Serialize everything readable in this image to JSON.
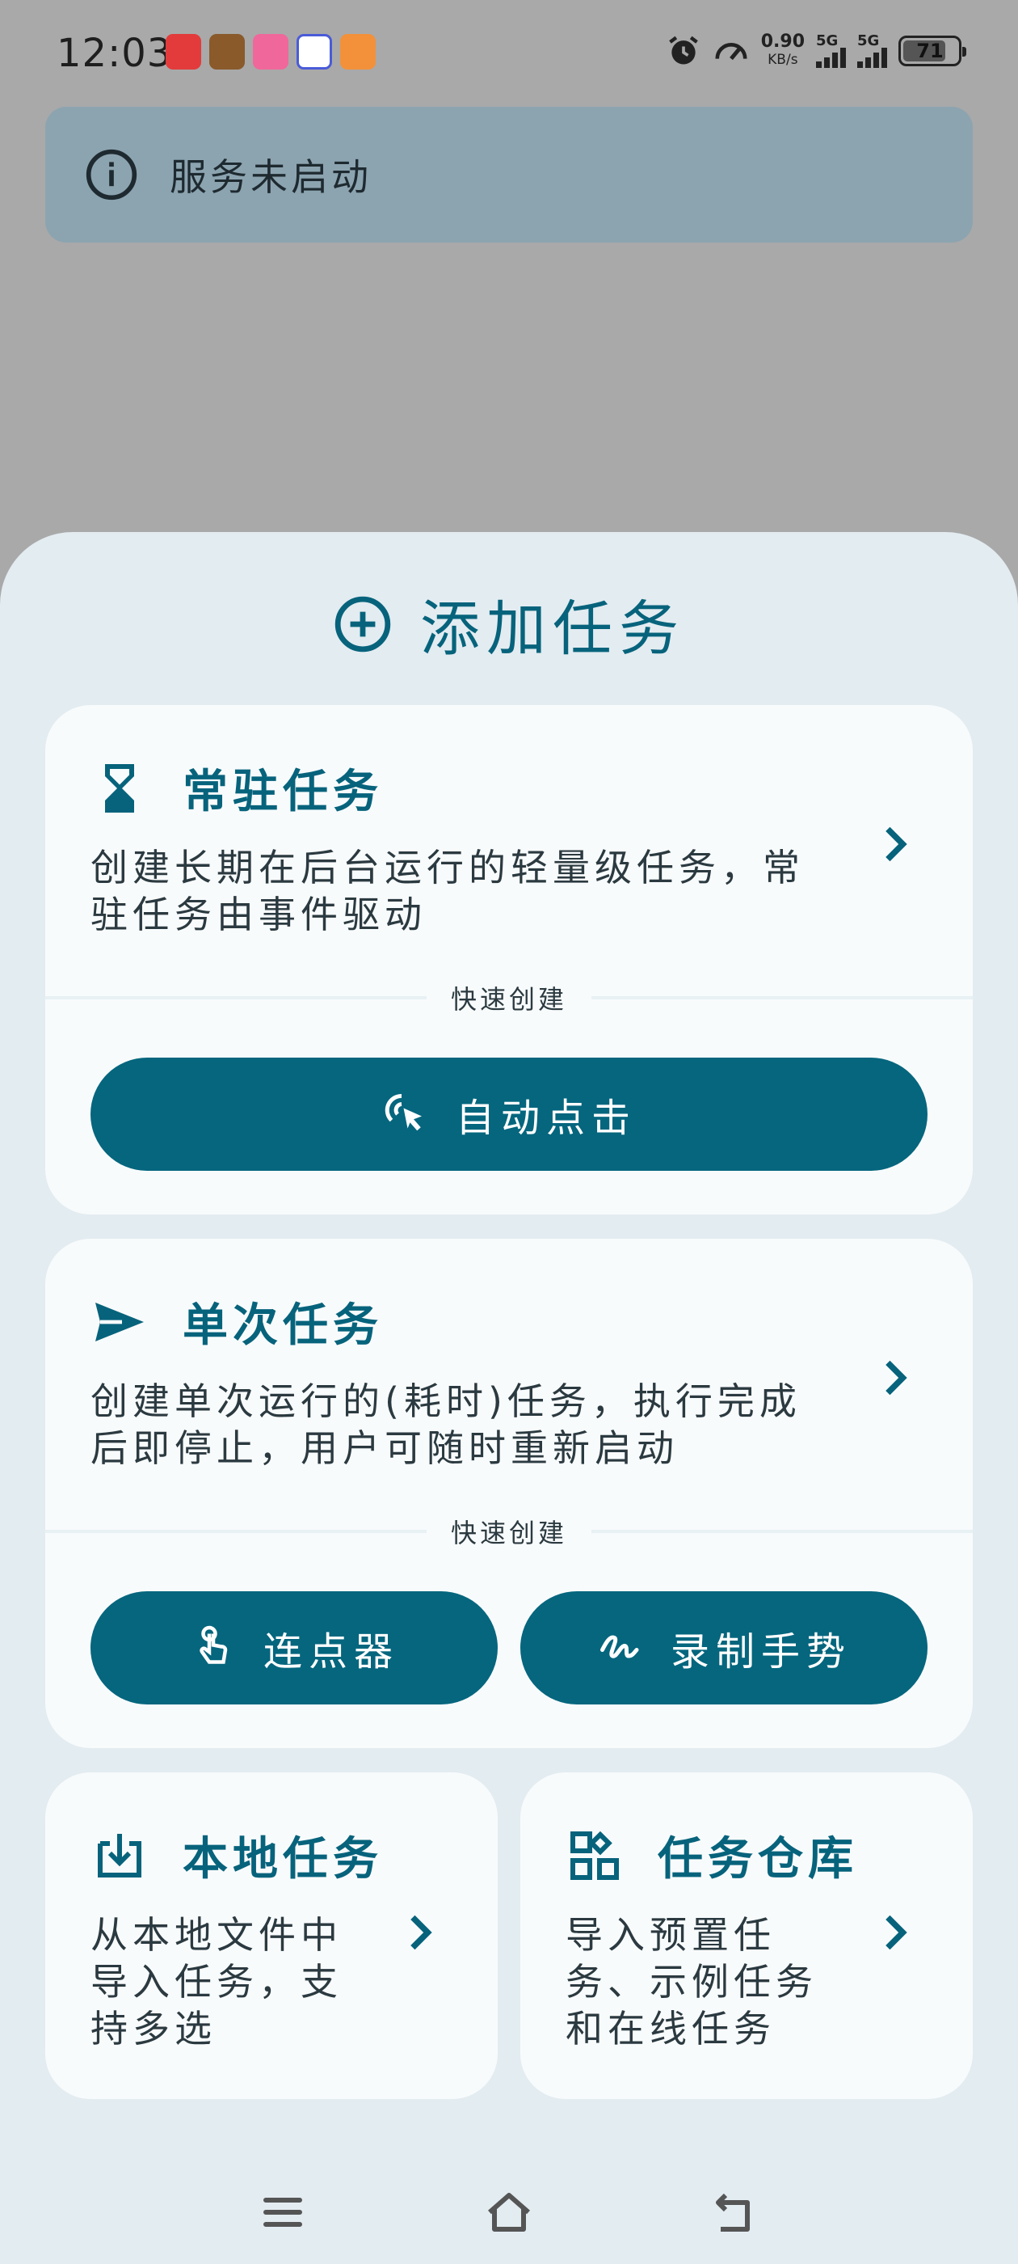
{
  "status_bar": {
    "time": "12:03",
    "net_speed_value": "0.90",
    "net_speed_unit": "KB/s",
    "signal1_label": "5G",
    "signal2_label": "5G",
    "battery": "71",
    "notification_icons": [
      "app-icon-red",
      "game-icon",
      "pink-app-icon",
      "tieba-icon",
      "orange-app-icon"
    ]
  },
  "banner": {
    "icon": "info-icon",
    "text": "服务未启动"
  },
  "sheet": {
    "icon": "add-circle-icon",
    "title": "添加任务"
  },
  "resident": {
    "icon": "hourglass-icon",
    "title": "常驻任务",
    "desc_line1": "创建长期在后台运行的轻量级任务，常",
    "desc_line2": "驻任务由事件驱动",
    "quick_label": "快速创建",
    "button_icon": "tap-cursor-icon",
    "button_label": "自动点击"
  },
  "once": {
    "icon": "send-icon",
    "title": "单次任务",
    "desc_line1": "创建单次运行的(耗时)任务，执行完成",
    "desc_line2": "后即停止，用户可随时重新启动",
    "quick_label": "快速创建",
    "button1_icon": "touch-hand-icon",
    "button1_label": "连点器",
    "button2_icon": "gesture-icon",
    "button2_label": "录制手势"
  },
  "local": {
    "icon": "download-icon",
    "title": "本地任务",
    "desc_line1": "从本地文件中",
    "desc_line2": "导入任务，支",
    "desc_line3": "持多选"
  },
  "repo": {
    "icon": "widgets-icon",
    "title": "任务仓库",
    "desc_line1": "导入预置任",
    "desc_line2": "务、示例任务",
    "desc_line3": "和在线任务"
  },
  "colors": {
    "accent": "#07637c",
    "button": "#05667e",
    "sheet_bg": "#e3ecf1",
    "card_bg": "#f8fbfc",
    "banner_bg": "#8ca4b0"
  }
}
